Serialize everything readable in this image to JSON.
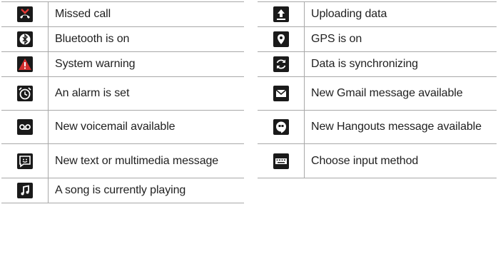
{
  "left_column": [
    {
      "icon": "missed-call-icon",
      "label": "Missed call"
    },
    {
      "icon": "bluetooth-icon",
      "label": "Bluetooth is on"
    },
    {
      "icon": "warning-icon",
      "label": "System warning"
    },
    {
      "icon": "alarm-icon",
      "label": "An alarm is set"
    },
    {
      "icon": "voicemail-icon",
      "label": "New voicemail available"
    },
    {
      "icon": "message-icon",
      "label": "New text or multimedia message"
    },
    {
      "icon": "music-icon",
      "label": "A song is currently playing"
    }
  ],
  "right_column": [
    {
      "icon": "upload-icon",
      "label": "Uploading data"
    },
    {
      "icon": "gps-icon",
      "label": "GPS is on"
    },
    {
      "icon": "sync-icon",
      "label": "Data is synchronizing"
    },
    {
      "icon": "gmail-icon",
      "label": "New Gmail message available"
    },
    {
      "icon": "hangouts-icon",
      "label": "New Hangouts message available"
    },
    {
      "icon": "keyboard-icon",
      "label": "Choose input method"
    }
  ],
  "colors": {
    "icon_dark": "#1a1a1a",
    "warning_red": "#d32f2f",
    "missed_red": "#e53935",
    "border": "#a8a8a8"
  }
}
